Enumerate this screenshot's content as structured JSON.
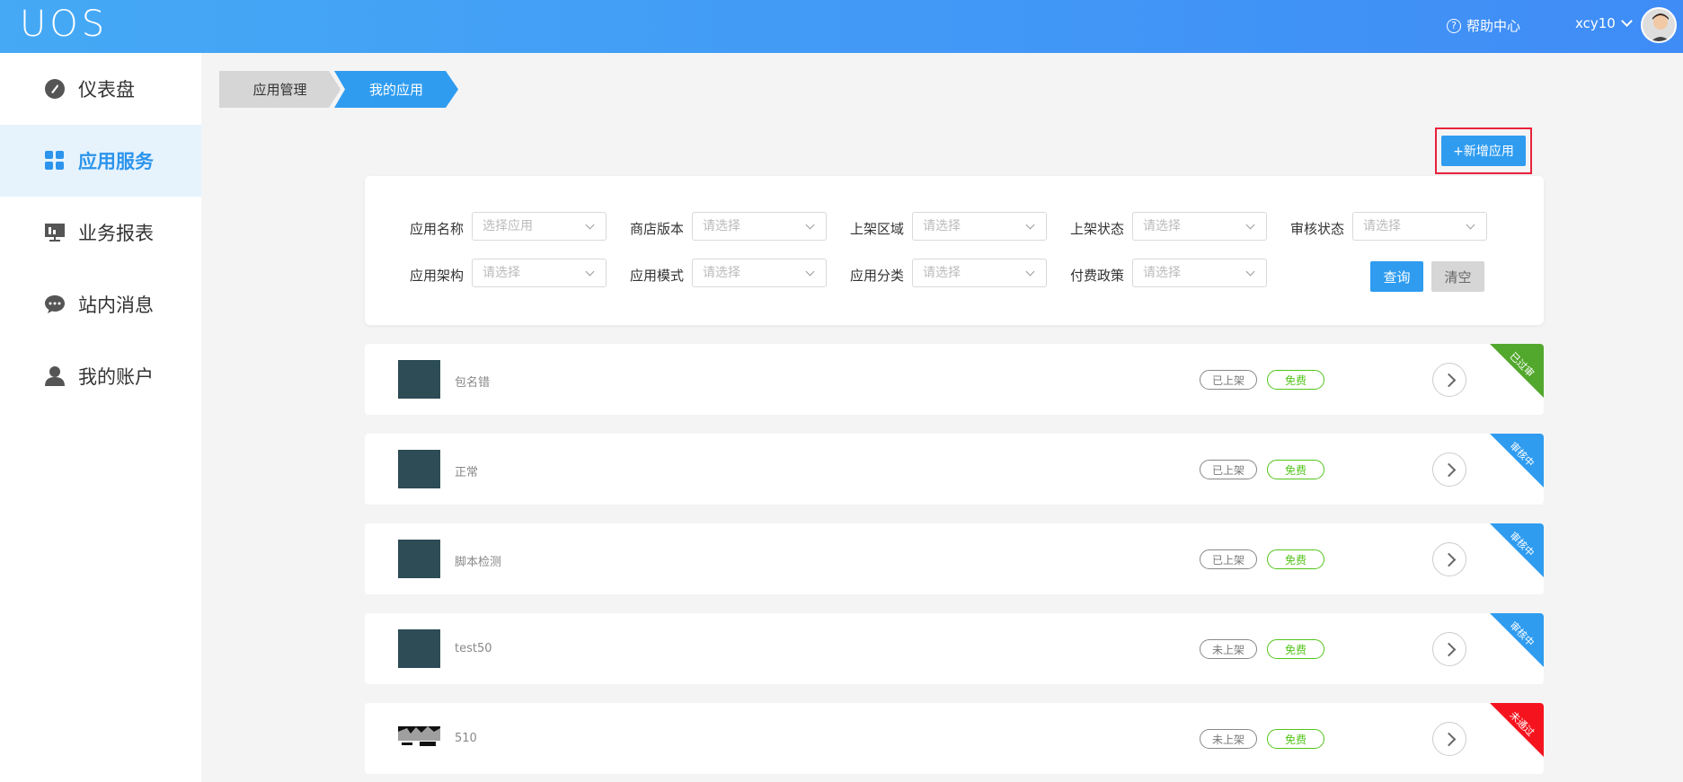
{
  "header": {
    "logo": "UOS",
    "help_label": "帮助中心",
    "username": "xcy10"
  },
  "sidebar": {
    "items": [
      {
        "label": "仪表盘",
        "icon": "dashboard-icon"
      },
      {
        "label": "应用服务",
        "icon": "grid-icon",
        "active": true
      },
      {
        "label": "业务报表",
        "icon": "report-icon"
      },
      {
        "label": "站内消息",
        "icon": "message-icon"
      },
      {
        "label": "我的账户",
        "icon": "user-icon"
      }
    ]
  },
  "breadcrumb": {
    "level1": "应用管理",
    "level2": "我的应用"
  },
  "actions": {
    "new_app": "+新增应用"
  },
  "filters": {
    "app_name": {
      "label": "应用名称",
      "placeholder": "选择应用"
    },
    "store_version": {
      "label": "商店版本",
      "placeholder": "请选择"
    },
    "listing_region": {
      "label": "上架区域",
      "placeholder": "请选择"
    },
    "listing_status": {
      "label": "上架状态",
      "placeholder": "请选择"
    },
    "review_status": {
      "label": "审核状态",
      "placeholder": "请选择"
    },
    "app_arch": {
      "label": "应用架构",
      "placeholder": "请选择"
    },
    "app_mode": {
      "label": "应用模式",
      "placeholder": "请选择"
    },
    "app_category": {
      "label": "应用分类",
      "placeholder": "请选择"
    },
    "pay_policy": {
      "label": "付费政策",
      "placeholder": "请选择"
    },
    "query_label": "查询",
    "clear_label": "清空"
  },
  "apps": [
    {
      "name": "包名错",
      "listing": "已上架",
      "fee": "免费",
      "review": "已过审",
      "review_color": "#52a82c"
    },
    {
      "name": "正常",
      "listing": "已上架",
      "fee": "免费",
      "review": "审核中",
      "review_color": "#2f9cf0"
    },
    {
      "name": "脚本检测",
      "listing": "已上架",
      "fee": "免费",
      "review": "审核中",
      "review_color": "#2f9cf0"
    },
    {
      "name": "test50",
      "listing": "未上架",
      "fee": "免费",
      "review": "审核中",
      "review_color": "#2f9cf0"
    },
    {
      "name": "510",
      "listing": "未上架",
      "fee": "免费",
      "review": "未通过",
      "review_color": "#f5141e"
    }
  ],
  "colors": {
    "accent": "#2f9cf0",
    "header_start": "#45a9f5",
    "header_end": "#3f8cf6",
    "highlight_border": "#e8223b",
    "fee_green": "#52c41a"
  }
}
